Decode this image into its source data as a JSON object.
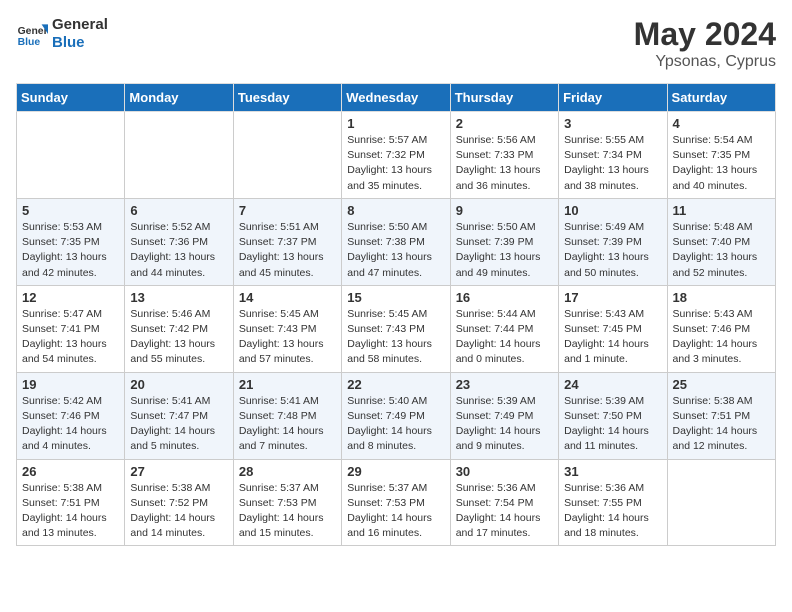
{
  "logo": {
    "line1": "General",
    "line2": "Blue"
  },
  "title": {
    "month_year": "May 2024",
    "location": "Ypsonas, Cyprus"
  },
  "weekdays": [
    "Sunday",
    "Monday",
    "Tuesday",
    "Wednesday",
    "Thursday",
    "Friday",
    "Saturday"
  ],
  "weeks": [
    [
      {
        "day": "",
        "info": ""
      },
      {
        "day": "",
        "info": ""
      },
      {
        "day": "",
        "info": ""
      },
      {
        "day": "1",
        "info": "Sunrise: 5:57 AM\nSunset: 7:32 PM\nDaylight: 13 hours\nand 35 minutes."
      },
      {
        "day": "2",
        "info": "Sunrise: 5:56 AM\nSunset: 7:33 PM\nDaylight: 13 hours\nand 36 minutes."
      },
      {
        "day": "3",
        "info": "Sunrise: 5:55 AM\nSunset: 7:34 PM\nDaylight: 13 hours\nand 38 minutes."
      },
      {
        "day": "4",
        "info": "Sunrise: 5:54 AM\nSunset: 7:35 PM\nDaylight: 13 hours\nand 40 minutes."
      }
    ],
    [
      {
        "day": "5",
        "info": "Sunrise: 5:53 AM\nSunset: 7:35 PM\nDaylight: 13 hours\nand 42 minutes."
      },
      {
        "day": "6",
        "info": "Sunrise: 5:52 AM\nSunset: 7:36 PM\nDaylight: 13 hours\nand 44 minutes."
      },
      {
        "day": "7",
        "info": "Sunrise: 5:51 AM\nSunset: 7:37 PM\nDaylight: 13 hours\nand 45 minutes."
      },
      {
        "day": "8",
        "info": "Sunrise: 5:50 AM\nSunset: 7:38 PM\nDaylight: 13 hours\nand 47 minutes."
      },
      {
        "day": "9",
        "info": "Sunrise: 5:50 AM\nSunset: 7:39 PM\nDaylight: 13 hours\nand 49 minutes."
      },
      {
        "day": "10",
        "info": "Sunrise: 5:49 AM\nSunset: 7:39 PM\nDaylight: 13 hours\nand 50 minutes."
      },
      {
        "day": "11",
        "info": "Sunrise: 5:48 AM\nSunset: 7:40 PM\nDaylight: 13 hours\nand 52 minutes."
      }
    ],
    [
      {
        "day": "12",
        "info": "Sunrise: 5:47 AM\nSunset: 7:41 PM\nDaylight: 13 hours\nand 54 minutes."
      },
      {
        "day": "13",
        "info": "Sunrise: 5:46 AM\nSunset: 7:42 PM\nDaylight: 13 hours\nand 55 minutes."
      },
      {
        "day": "14",
        "info": "Sunrise: 5:45 AM\nSunset: 7:43 PM\nDaylight: 13 hours\nand 57 minutes."
      },
      {
        "day": "15",
        "info": "Sunrise: 5:45 AM\nSunset: 7:43 PM\nDaylight: 13 hours\nand 58 minutes."
      },
      {
        "day": "16",
        "info": "Sunrise: 5:44 AM\nSunset: 7:44 PM\nDaylight: 14 hours\nand 0 minutes."
      },
      {
        "day": "17",
        "info": "Sunrise: 5:43 AM\nSunset: 7:45 PM\nDaylight: 14 hours\nand 1 minute."
      },
      {
        "day": "18",
        "info": "Sunrise: 5:43 AM\nSunset: 7:46 PM\nDaylight: 14 hours\nand 3 minutes."
      }
    ],
    [
      {
        "day": "19",
        "info": "Sunrise: 5:42 AM\nSunset: 7:46 PM\nDaylight: 14 hours\nand 4 minutes."
      },
      {
        "day": "20",
        "info": "Sunrise: 5:41 AM\nSunset: 7:47 PM\nDaylight: 14 hours\nand 5 minutes."
      },
      {
        "day": "21",
        "info": "Sunrise: 5:41 AM\nSunset: 7:48 PM\nDaylight: 14 hours\nand 7 minutes."
      },
      {
        "day": "22",
        "info": "Sunrise: 5:40 AM\nSunset: 7:49 PM\nDaylight: 14 hours\nand 8 minutes."
      },
      {
        "day": "23",
        "info": "Sunrise: 5:39 AM\nSunset: 7:49 PM\nDaylight: 14 hours\nand 9 minutes."
      },
      {
        "day": "24",
        "info": "Sunrise: 5:39 AM\nSunset: 7:50 PM\nDaylight: 14 hours\nand 11 minutes."
      },
      {
        "day": "25",
        "info": "Sunrise: 5:38 AM\nSunset: 7:51 PM\nDaylight: 14 hours\nand 12 minutes."
      }
    ],
    [
      {
        "day": "26",
        "info": "Sunrise: 5:38 AM\nSunset: 7:51 PM\nDaylight: 14 hours\nand 13 minutes."
      },
      {
        "day": "27",
        "info": "Sunrise: 5:38 AM\nSunset: 7:52 PM\nDaylight: 14 hours\nand 14 minutes."
      },
      {
        "day": "28",
        "info": "Sunrise: 5:37 AM\nSunset: 7:53 PM\nDaylight: 14 hours\nand 15 minutes."
      },
      {
        "day": "29",
        "info": "Sunrise: 5:37 AM\nSunset: 7:53 PM\nDaylight: 14 hours\nand 16 minutes."
      },
      {
        "day": "30",
        "info": "Sunrise: 5:36 AM\nSunset: 7:54 PM\nDaylight: 14 hours\nand 17 minutes."
      },
      {
        "day": "31",
        "info": "Sunrise: 5:36 AM\nSunset: 7:55 PM\nDaylight: 14 hours\nand 18 minutes."
      },
      {
        "day": "",
        "info": ""
      }
    ]
  ]
}
